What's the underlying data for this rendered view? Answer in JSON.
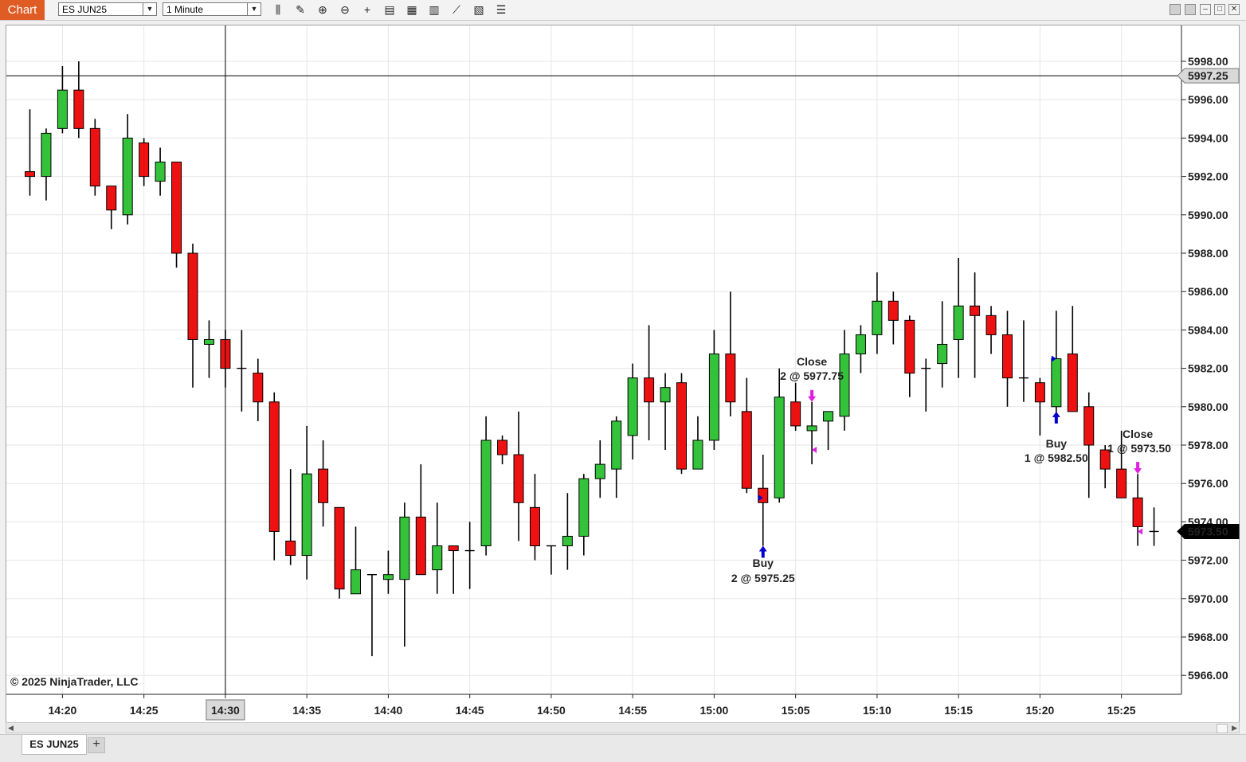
{
  "toolbar": {
    "app_title": "Chart",
    "instrument": "ES JUN25",
    "interval": "1 Minute",
    "tools": [
      {
        "icon": "bar-type-icon",
        "glyph": "⫼"
      },
      {
        "icon": "draw-pencil-icon",
        "glyph": "✎"
      },
      {
        "icon": "zoom-in-icon",
        "glyph": "⊕"
      },
      {
        "icon": "zoom-out-icon",
        "glyph": "⊖"
      },
      {
        "icon": "crosshair-icon",
        "glyph": "+"
      },
      {
        "icon": "data-series-icon",
        "glyph": "▤"
      },
      {
        "icon": "templates-icon",
        "glyph": "▦"
      },
      {
        "icon": "indicators-icon",
        "glyph": "▥"
      },
      {
        "icon": "strategies-icon",
        "glyph": "⟋"
      },
      {
        "icon": "chart-trader-icon",
        "glyph": "▧"
      },
      {
        "icon": "properties-icon",
        "glyph": "☰"
      }
    ]
  },
  "chart": {
    "price_labels": [
      "5998.00",
      "5996.00",
      "5994.00",
      "5992.00",
      "5990.00",
      "5988.00",
      "5986.00",
      "5984.00",
      "5982.00",
      "5980.00",
      "5978.00",
      "5976.00",
      "5974.00",
      "5972.00",
      "5970.00",
      "5968.00",
      "5966.00"
    ],
    "time_labels": [
      "14:20",
      "14:25",
      "14:30",
      "14:35",
      "14:40",
      "14:45",
      "14:50",
      "14:55",
      "15:00",
      "15:05",
      "15:10",
      "15:15",
      "15:20",
      "15:25"
    ],
    "crosshair_time": "14:30",
    "crosshair_price": "5997.25",
    "last_price": "5973.50",
    "copyright": "© 2025 NinjaTrader, LLC",
    "colors": {
      "up": "#33c23a",
      "down": "#ee1111",
      "buy_arrow": "#0000cc",
      "close_arrow": "#e020e0",
      "grid": "#e6e6e6"
    },
    "annotations": [
      {
        "id": "buy1",
        "l1": "Buy",
        "l2": "2 @ 5975.25"
      },
      {
        "id": "close1",
        "l1": "Close",
        "l2": "2 @ 5977.75"
      },
      {
        "id": "buy2",
        "l1": "Buy",
        "l2": "1 @ 5982.50"
      },
      {
        "id": "close2",
        "l1": "Close",
        "l2": "1 @ 5973.50"
      }
    ],
    "candles": [
      {
        "o": 5992.25,
        "h": 5995.5,
        "l": 5991.0,
        "c": 5992.0
      },
      {
        "o": 5992.0,
        "h": 5994.5,
        "l": 5990.75,
        "c": 5994.25
      },
      {
        "o": 5994.5,
        "h": 5997.75,
        "l": 5994.25,
        "c": 5996.5
      },
      {
        "o": 5996.5,
        "h": 5998.0,
        "l": 5994.0,
        "c": 5994.5
      },
      {
        "o": 5994.5,
        "h": 5995.0,
        "l": 5991.0,
        "c": 5991.5
      },
      {
        "o": 5991.5,
        "h": 5991.5,
        "l": 5989.25,
        "c": 5990.25
      },
      {
        "o": 5990.0,
        "h": 5995.25,
        "l": 5989.5,
        "c": 5994.0
      },
      {
        "o": 5993.75,
        "h": 5994.0,
        "l": 5991.5,
        "c": 5992.0
      },
      {
        "o": 5991.75,
        "h": 5993.5,
        "l": 5991.0,
        "c": 5992.75
      },
      {
        "o": 5992.75,
        "h": 5992.75,
        "l": 5987.25,
        "c": 5988.0
      },
      {
        "o": 5988.0,
        "h": 5988.5,
        "l": 5981.0,
        "c": 5983.5
      },
      {
        "o": 5983.25,
        "h": 5984.5,
        "l": 5981.5,
        "c": 5983.5
      },
      {
        "o": 5983.5,
        "h": 5984.0,
        "l": 5981.0,
        "c": 5982.0
      },
      {
        "o": 5982.0,
        "h": 5984.0,
        "l": 5979.75,
        "c": 5982.0
      },
      {
        "o": 5981.75,
        "h": 5982.5,
        "l": 5979.25,
        "c": 5980.25
      },
      {
        "o": 5980.25,
        "h": 5980.75,
        "l": 5972.0,
        "c": 5973.5
      },
      {
        "o": 5973.0,
        "h": 5976.75,
        "l": 5971.75,
        "c": 5972.25
      },
      {
        "o": 5972.25,
        "h": 5979.0,
        "l": 5971.0,
        "c": 5976.5
      },
      {
        "o": 5976.75,
        "h": 5978.25,
        "l": 5973.75,
        "c": 5975.0
      },
      {
        "o": 5974.75,
        "h": 5974.75,
        "l": 5970.0,
        "c": 5970.5
      },
      {
        "o": 5970.25,
        "h": 5973.75,
        "l": 5970.25,
        "c": 5971.5
      },
      {
        "o": 5971.25,
        "h": 5971.25,
        "l": 5967.0,
        "c": 5971.25
      },
      {
        "o": 5971.0,
        "h": 5972.5,
        "l": 5970.25,
        "c": 5971.25
      },
      {
        "o": 5971.0,
        "h": 5975.0,
        "l": 5967.5,
        "c": 5974.25
      },
      {
        "o": 5974.25,
        "h": 5977.0,
        "l": 5971.5,
        "c": 5971.25
      },
      {
        "o": 5971.5,
        "h": 5975.0,
        "l": 5970.25,
        "c": 5972.75
      },
      {
        "o": 5972.75,
        "h": 5972.75,
        "l": 5970.25,
        "c": 5972.5
      },
      {
        "o": 5972.5,
        "h": 5974.0,
        "l": 5970.5,
        "c": 5972.5
      },
      {
        "o": 5972.75,
        "h": 5979.5,
        "l": 5972.25,
        "c": 5978.25
      },
      {
        "o": 5978.25,
        "h": 5978.5,
        "l": 5977.0,
        "c": 5977.5
      },
      {
        "o": 5977.5,
        "h": 5979.75,
        "l": 5973.0,
        "c": 5975.0
      },
      {
        "o": 5974.75,
        "h": 5976.5,
        "l": 5972.0,
        "c": 5972.75
      },
      {
        "o": 5972.75,
        "h": 5972.75,
        "l": 5971.25,
        "c": 5972.75
      },
      {
        "o": 5972.75,
        "h": 5975.5,
        "l": 5971.5,
        "c": 5973.25
      },
      {
        "o": 5973.25,
        "h": 5976.5,
        "l": 5972.25,
        "c": 5976.25
      },
      {
        "o": 5976.25,
        "h": 5978.25,
        "l": 5975.25,
        "c": 5977.0
      },
      {
        "o": 5976.75,
        "h": 5979.5,
        "l": 5975.25,
        "c": 5979.25
      },
      {
        "o": 5978.5,
        "h": 5982.25,
        "l": 5977.25,
        "c": 5981.5
      },
      {
        "o": 5981.5,
        "h": 5984.25,
        "l": 5978.25,
        "c": 5980.25
      },
      {
        "o": 5980.25,
        "h": 5981.75,
        "l": 5977.75,
        "c": 5981.0
      },
      {
        "o": 5981.25,
        "h": 5981.75,
        "l": 5976.5,
        "c": 5976.75
      },
      {
        "o": 5976.75,
        "h": 5979.5,
        "l": 5976.75,
        "c": 5978.25
      },
      {
        "o": 5978.25,
        "h": 5984.0,
        "l": 5977.75,
        "c": 5982.75
      },
      {
        "o": 5982.75,
        "h": 5986.0,
        "l": 5979.5,
        "c": 5980.25
      },
      {
        "o": 5979.75,
        "h": 5981.5,
        "l": 5975.5,
        "c": 5975.75
      },
      {
        "o": 5975.75,
        "h": 5977.5,
        "l": 5972.75,
        "c": 5975.0
      },
      {
        "o": 5975.25,
        "h": 5982.0,
        "l": 5975.0,
        "c": 5980.5
      },
      {
        "o": 5980.25,
        "h": 5981.25,
        "l": 5978.75,
        "c": 5979.0
      },
      {
        "o": 5978.75,
        "h": 5980.25,
        "l": 5977.0,
        "c": 5979.0
      },
      {
        "o": 5979.25,
        "h": 5979.75,
        "l": 5977.75,
        "c": 5979.75
      },
      {
        "o": 5979.5,
        "h": 5984.0,
        "l": 5978.75,
        "c": 5982.75
      },
      {
        "o": 5982.75,
        "h": 5984.25,
        "l": 5981.75,
        "c": 5983.75
      },
      {
        "o": 5983.75,
        "h": 5987.0,
        "l": 5982.75,
        "c": 5985.5
      },
      {
        "o": 5985.5,
        "h": 5986.0,
        "l": 5983.25,
        "c": 5984.5
      },
      {
        "o": 5984.5,
        "h": 5984.75,
        "l": 5980.5,
        "c": 5981.75
      },
      {
        "o": 5982.0,
        "h": 5982.5,
        "l": 5979.75,
        "c": 5982.0
      },
      {
        "o": 5982.25,
        "h": 5985.5,
        "l": 5981.0,
        "c": 5983.25
      },
      {
        "o": 5983.5,
        "h": 5987.75,
        "l": 5981.5,
        "c": 5985.25
      },
      {
        "o": 5985.25,
        "h": 5987.0,
        "l": 5981.5,
        "c": 5984.75
      },
      {
        "o": 5984.75,
        "h": 5985.25,
        "l": 5982.75,
        "c": 5983.75
      },
      {
        "o": 5983.75,
        "h": 5985.0,
        "l": 5980.0,
        "c": 5981.5
      },
      {
        "o": 5981.5,
        "h": 5984.5,
        "l": 5980.25,
        "c": 5981.5
      },
      {
        "o": 5981.25,
        "h": 5981.5,
        "l": 5978.5,
        "c": 5980.25
      },
      {
        "o": 5980.0,
        "h": 5985.0,
        "l": 5979.25,
        "c": 5982.5
      },
      {
        "o": 5982.75,
        "h": 5985.25,
        "l": 5979.75,
        "c": 5979.75
      },
      {
        "o": 5980.0,
        "h": 5980.75,
        "l": 5975.25,
        "c": 5978.0
      },
      {
        "o": 5977.75,
        "h": 5978.0,
        "l": 5975.75,
        "c": 5976.75
      },
      {
        "o": 5976.75,
        "h": 5978.75,
        "l": 5975.25,
        "c": 5975.25
      },
      {
        "o": 5975.25,
        "h": 5976.5,
        "l": 5972.75,
        "c": 5973.75
      },
      {
        "o": 5973.5,
        "h": 5974.75,
        "l": 5972.75,
        "c": 5973.5
      }
    ]
  }
}
